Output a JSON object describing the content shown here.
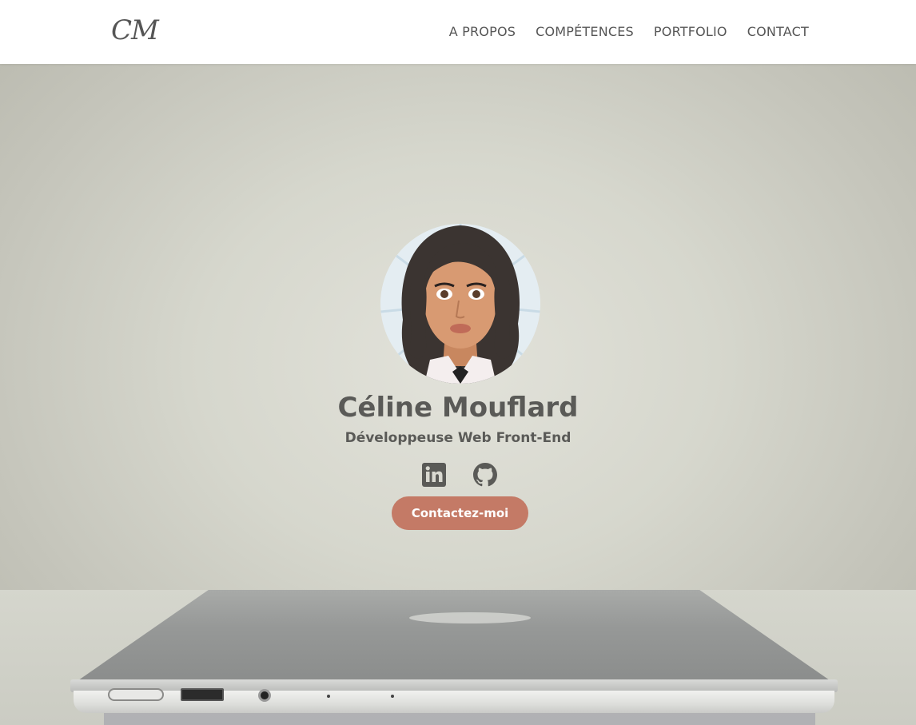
{
  "header": {
    "logo": "CM",
    "nav": [
      {
        "label": "A PROPOS"
      },
      {
        "label": "COMPÉTENCES"
      },
      {
        "label": "PORTFOLIO"
      },
      {
        "label": "CONTACT"
      }
    ]
  },
  "hero": {
    "name": "Céline Mouflard",
    "subtitle": "Développeuse Web Front-End",
    "socials": [
      {
        "icon": "linkedin-icon"
      },
      {
        "icon": "github-icon"
      }
    ],
    "cta_label": "Contactez-moi"
  },
  "colors": {
    "accent": "#c47a66",
    "text": "#5a5a57",
    "nav_text": "#555555"
  }
}
